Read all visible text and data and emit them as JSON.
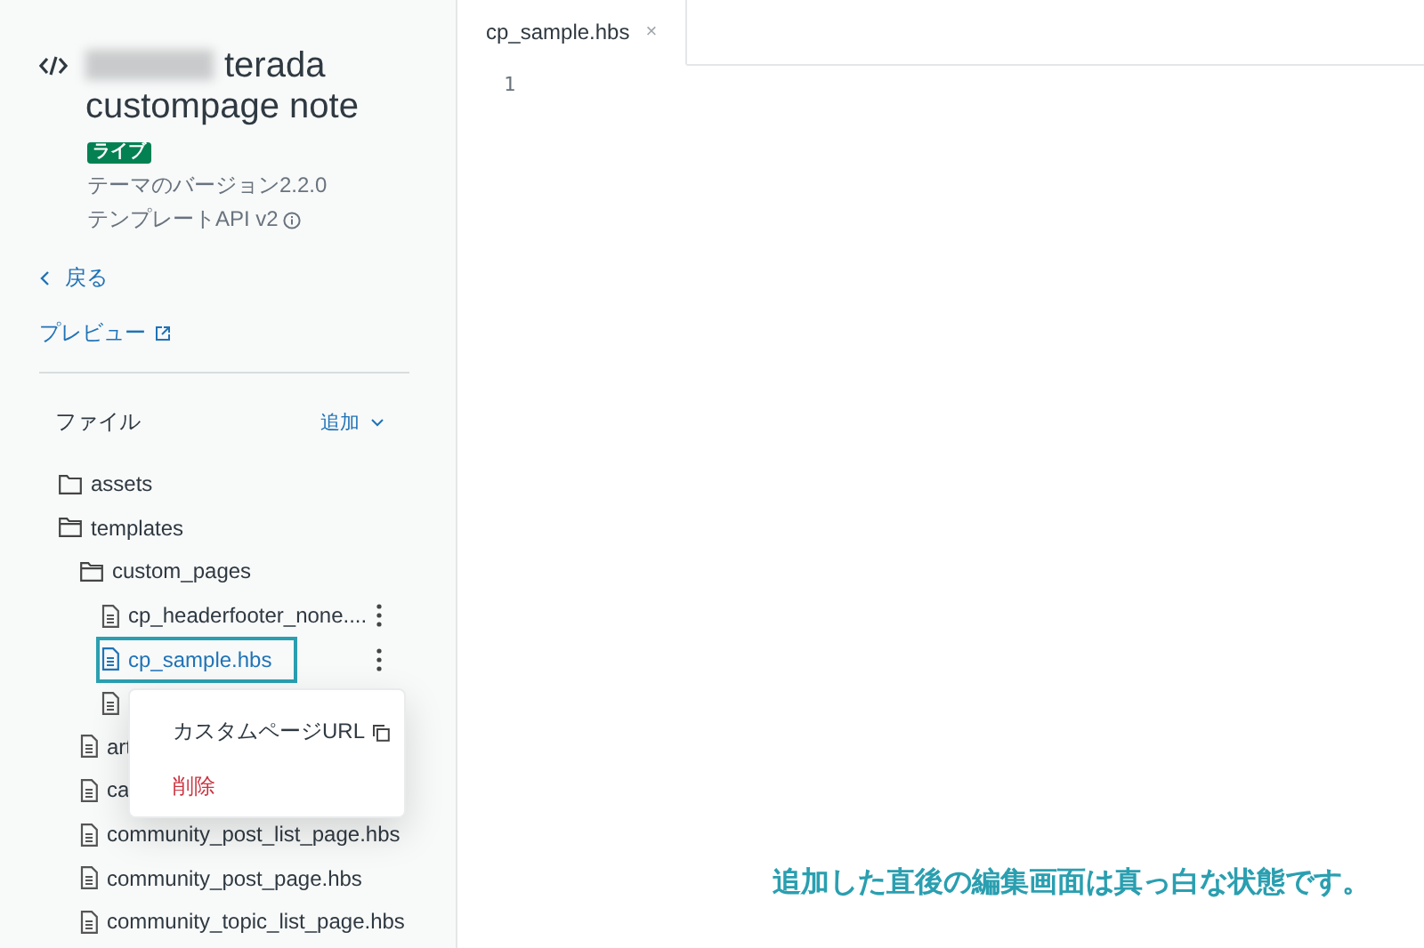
{
  "theme": {
    "title_line_1": "terada",
    "title_line_2": "custompage note",
    "badge": "ライブ",
    "version": "テーマのバージョン2.2.0",
    "template_api": "テンプレートAPI v2"
  },
  "nav": {
    "back": "戻る",
    "preview": "プレビュー"
  },
  "files": {
    "heading": "ファイル",
    "add": "追加",
    "tree": [
      {
        "kind": "folder",
        "name": "assets",
        "expanded": false,
        "selected": false
      },
      {
        "kind": "folder",
        "name": "templates",
        "expanded": true,
        "selected": false,
        "children": [
          {
            "kind": "folder",
            "name": "custom_pages",
            "expanded": true,
            "selected": false,
            "children": [
              {
                "kind": "file",
                "name": "cp_headerfooter_none....",
                "selected": false,
                "actions": true
              },
              {
                "kind": "file",
                "name": "cp_sample.hbs",
                "selected": true,
                "actions": true
              },
              {
                "kind": "file",
                "selected": false
              }
            ]
          },
          {
            "kind": "file",
            "name": "art",
            "selected": false
          },
          {
            "kind": "file",
            "name": "ca",
            "selected": false
          },
          {
            "kind": "file",
            "name": "community_post_list_page.hbs",
            "selected": false
          },
          {
            "kind": "file",
            "name": "community_post_page.hbs",
            "selected": false
          },
          {
            "kind": "file",
            "name": "community_topic_list_page.hbs",
            "selected": false
          }
        ]
      }
    ]
  },
  "context_menu": [
    {
      "kind": "copy",
      "label": "カスタムページURL"
    },
    {
      "kind": "danger",
      "label": "削除"
    }
  ],
  "editor": {
    "tabs": [
      {
        "label": "cp_sample.hbs",
        "close": "×",
        "selected": true
      }
    ],
    "line_numbers": [
      "1"
    ]
  },
  "annotation": "追加した直後の編集画面は真っ白な状態です。"
}
